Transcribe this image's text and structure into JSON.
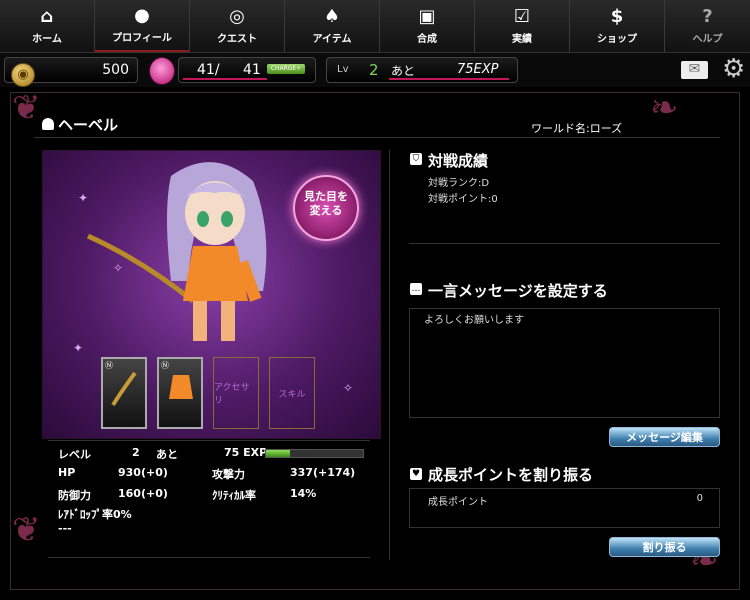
{
  "nav": [
    {
      "label": "ホーム",
      "icon": "home-icon",
      "glyph": "⌂"
    },
    {
      "label": "プロフィール",
      "icon": "user-icon",
      "glyph": "●"
    },
    {
      "label": "クエスト",
      "icon": "target-icon",
      "glyph": "◎"
    },
    {
      "label": "アイテム",
      "icon": "cards-icon",
      "glyph": "♠"
    },
    {
      "label": "合成",
      "icon": "fuse-icon",
      "glyph": "▣"
    },
    {
      "label": "実績",
      "icon": "check-icon",
      "glyph": "☑"
    },
    {
      "label": "ショップ",
      "icon": "coin-icon",
      "glyph": "$"
    },
    {
      "label": "ヘルプ",
      "icon": "help-icon",
      "glyph": "?"
    }
  ],
  "status": {
    "gold": "500",
    "stamina_current": "41/",
    "stamina_max": "41",
    "charge_label": "CHARGE+",
    "lv_label": "Lv",
    "level": "2",
    "remaining_label": "あと",
    "exp_needed": "75EXP"
  },
  "header": {
    "player_name": "ヘーベル",
    "world": "ワールド名:ローズ"
  },
  "portrait": {
    "change_look": "見た目を変える"
  },
  "equipment": {
    "slot3": "アクセサリ",
    "slot4": "スキル"
  },
  "stats": {
    "level_label": "レベル",
    "level_value": "2",
    "remaining_label": "あと",
    "exp_value": "75 EXP",
    "exp_progress": 0.25,
    "hp_label": "HP",
    "hp_value": "930(+0)",
    "atk_label": "攻撃力",
    "atk_value": "337(+174)",
    "def_label": "防御力",
    "def_value": "160(+0)",
    "crit_label": "ｸﾘﾃｨｶﾙ率",
    "crit_value": "14%",
    "rare_drop": "ﾚｱﾄﾞﾛｯﾌﾟ率0%",
    "dashes": "---"
  },
  "battle": {
    "title": "対戦成績",
    "rank": "対戦ランク:D",
    "points": "対戦ポイント:0"
  },
  "message": {
    "title": "一言メッセージを設定する",
    "text": "よろしくお願いします",
    "edit_button": "メッセージ編集"
  },
  "growth": {
    "title": "成長ポイントを割り振る",
    "label": "成長ポイント",
    "value": "0",
    "assign_button": "割り振る"
  }
}
